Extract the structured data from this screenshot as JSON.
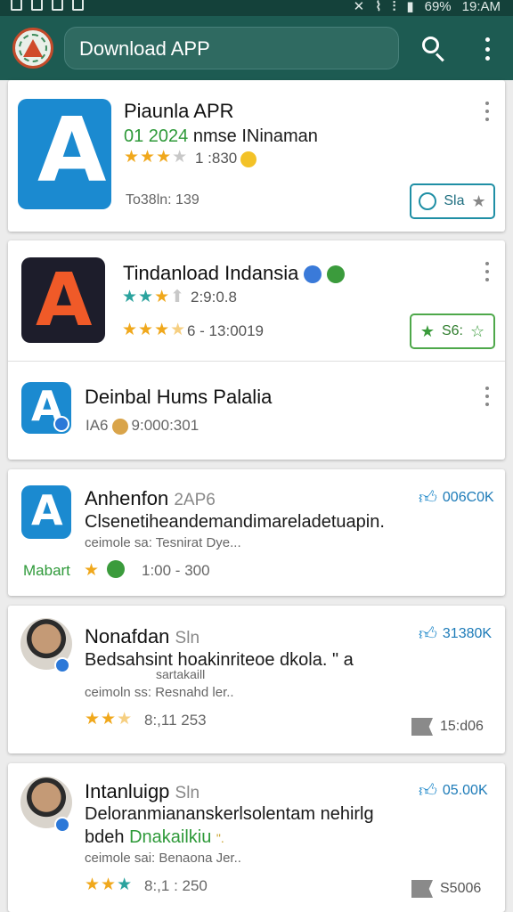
{
  "status_bar": {
    "signal": "69%",
    "time": "19:AM"
  },
  "search": {
    "value": "Download APP"
  },
  "cards": [
    {
      "title": "Piaunla APR",
      "subtitle_green": "01 2024",
      "subtitle_rest": " nmse INinaman",
      "rating_text": "1 :830",
      "meta": "To38ln: 139",
      "button_label": "Sla"
    },
    {
      "title": "Tindanload Indansia",
      "rating_text_1": "2:9:0.8",
      "rating_text_2": "6 - 13:0019",
      "button_label": "S6:"
    },
    {
      "title": "Deinbal Hums Palalia",
      "meta_prefix": "IA6",
      "meta_value": "9:000:301"
    },
    {
      "title": "Anhenfon",
      "title_suffix": "2AP6",
      "likes": "006C0K",
      "body": "Clsenetiheandemandimareladetuapin.",
      "meta": "ceimole sa: Tesnirat Dye...",
      "tag": "Mabart",
      "time": "1:00 - 300"
    },
    {
      "title": "Nonafdan",
      "title_suffix": "Sln",
      "likes": "31380K",
      "body": "Bedsahsint hoakinriteoe dkola.",
      "body_extra": "\" a",
      "sub_note": "sartakaill",
      "meta": "ceimoln ss: Resnahd ler..",
      "rating_text": "8:,11 253",
      "report_count": "15:d06"
    },
    {
      "title": "Intanluigp",
      "title_suffix": "Sln",
      "likes": "05.00K",
      "body_line1": "Deloranmiananskerlsolentam nehirlg",
      "body_line2_dark": "bdeh",
      "body_line2_green": "Dnakailkiu",
      "body_line2_mark": "\".",
      "meta": "ceimole sai: Benaona Jer..",
      "rating_text": "8:,1 : 250",
      "report_count": "S5006"
    }
  ]
}
